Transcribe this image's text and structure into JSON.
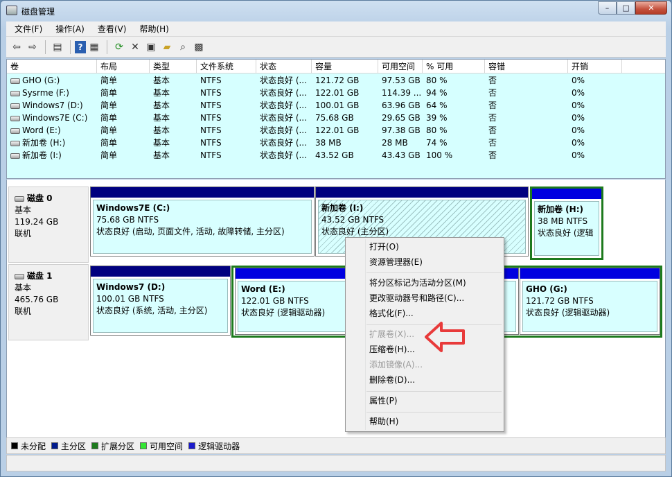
{
  "window": {
    "title": "磁盘管理",
    "min": "–",
    "max": "□",
    "close": "✕"
  },
  "menu": [
    "文件(F)",
    "操作(A)",
    "查看(V)",
    "帮助(H)"
  ],
  "toolbar_icons": [
    "back-icon",
    "forward-icon",
    "console-tree-icon",
    "help-icon",
    "properties-icon",
    "refresh-icon",
    "delete-icon",
    "settings-icon",
    "open-folder-icon",
    "search-icon",
    "export-icon"
  ],
  "columns": [
    "卷",
    "布局",
    "类型",
    "文件系统",
    "状态",
    "容量",
    "可用空间",
    "% 可用",
    "容错",
    "开销"
  ],
  "volumes": [
    {
      "name": "GHO (G:)",
      "layout": "简单",
      "type": "基本",
      "fs": "NTFS",
      "status": "状态良好 (...",
      "capacity": "121.72 GB",
      "free": "97.53 GB",
      "pct": "80 %",
      "fault": "否",
      "overhead": "0%"
    },
    {
      "name": "Sysrme (F:)",
      "layout": "简单",
      "type": "基本",
      "fs": "NTFS",
      "status": "状态良好 (...",
      "capacity": "122.01 GB",
      "free": "114.39 ...",
      "pct": "94 %",
      "fault": "否",
      "overhead": "0%"
    },
    {
      "name": "Windows7 (D:)",
      "layout": "简单",
      "type": "基本",
      "fs": "NTFS",
      "status": "状态良好 (...",
      "capacity": "100.01 GB",
      "free": "63.96 GB",
      "pct": "64 %",
      "fault": "否",
      "overhead": "0%"
    },
    {
      "name": "Windows7E (C:)",
      "layout": "简单",
      "type": "基本",
      "fs": "NTFS",
      "status": "状态良好 (...",
      "capacity": "75.68 GB",
      "free": "29.65 GB",
      "pct": "39 %",
      "fault": "否",
      "overhead": "0%"
    },
    {
      "name": "Word (E:)",
      "layout": "简单",
      "type": "基本",
      "fs": "NTFS",
      "status": "状态良好 (...",
      "capacity": "122.01 GB",
      "free": "97.38 GB",
      "pct": "80 %",
      "fault": "否",
      "overhead": "0%"
    },
    {
      "name": "新加卷 (H:)",
      "layout": "简单",
      "type": "基本",
      "fs": "NTFS",
      "status": "状态良好 (...",
      "capacity": "38 MB",
      "free": "28 MB",
      "pct": "74 %",
      "fault": "否",
      "overhead": "0%"
    },
    {
      "name": "新加卷 (I:)",
      "layout": "简单",
      "type": "基本",
      "fs": "NTFS",
      "status": "状态良好 (...",
      "capacity": "43.52 GB",
      "free": "43.43 GB",
      "pct": "100 %",
      "fault": "否",
      "overhead": "0%"
    }
  ],
  "disks": [
    {
      "name": "磁盘 0",
      "type": "基本",
      "size": "119.24 GB",
      "state": "联机",
      "partitions": [
        {
          "name": "Windows7E  (C:)",
          "size": "75.68 GB NTFS",
          "status": "状态良好 (启动, 页面文件, 活动, 故障转储, 主分区)"
        },
        {
          "name": "新加卷  (I:)",
          "size": "43.52 GB NTFS",
          "status": "状态良好 (主分区)"
        },
        {
          "name": "新加卷  (H:)",
          "size": "38 MB NTFS",
          "status": "状态良好 (逻辑"
        }
      ]
    },
    {
      "name": "磁盘 1",
      "type": "基本",
      "size": "465.76 GB",
      "state": "联机",
      "partitions": [
        {
          "name": "Windows7  (D:)",
          "size": "100.01 GB NTFS",
          "status": "状态良好 (系统, 活动, 主分区)"
        },
        {
          "name": "Word  (E:)",
          "size": "122.01 GB NTFS",
          "status": "状态良好 (逻辑驱动器)"
        },
        {
          "name": "GHO  (G:)",
          "size": "121.72 GB NTFS",
          "status": "状态良好 (逻辑驱动器)"
        }
      ]
    }
  ],
  "legend": [
    "未分配",
    "主分区",
    "扩展分区",
    "可用空间",
    "逻辑驱动器"
  ],
  "legend_colors": [
    "#000000",
    "#001a8c",
    "#1d7a1d",
    "#33e633",
    "#1a1acc"
  ],
  "context_menu": [
    "打开(O)",
    "资源管理器(E)",
    "将分区标记为活动分区(M)",
    "更改驱动器号和路径(C)...",
    "格式化(F)...",
    "扩展卷(X)...",
    "压缩卷(H)...",
    "添加镜像(A)...",
    "删除卷(D)...",
    "属性(P)",
    "帮助(H)"
  ],
  "colors": {
    "primary_bar": "#00007f",
    "logical_bar": "#0000e0",
    "extended": "#1d7a1d",
    "arrow": "#e83a3a"
  }
}
